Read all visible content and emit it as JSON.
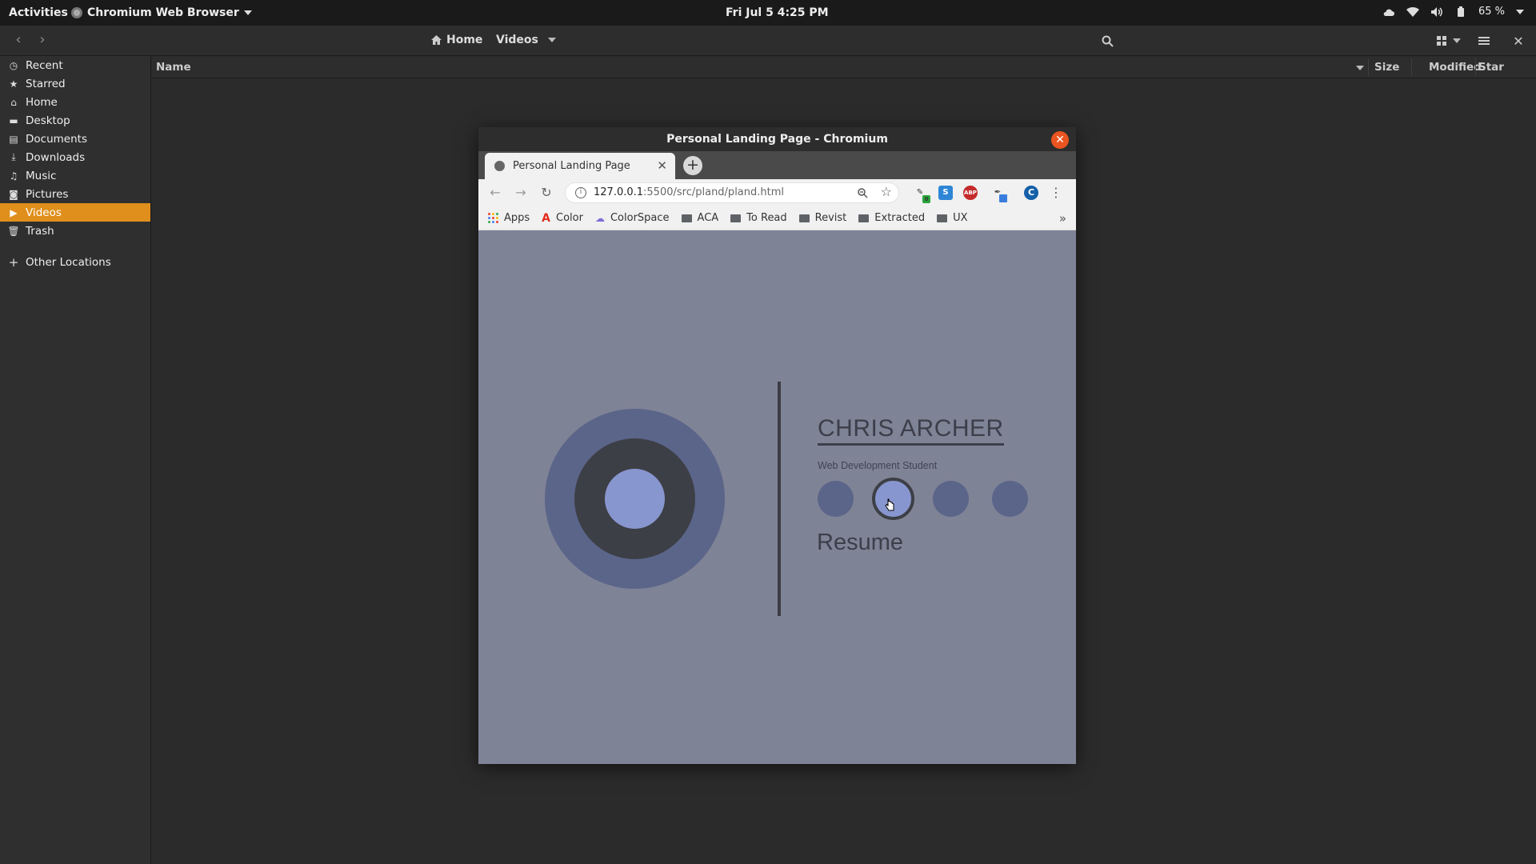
{
  "topbar": {
    "activities": "Activities",
    "app_name": "Chromium Web Browser",
    "clock": "Fri Jul 5   4:25 PM",
    "battery": "65 %"
  },
  "files": {
    "path_home": "Home",
    "path_current": "Videos",
    "columns": {
      "name": "Name",
      "size": "Size",
      "modified": "Modified",
      "star": "Star"
    },
    "sidebar": [
      {
        "label": "Recent",
        "icon": "clock-icon"
      },
      {
        "label": "Starred",
        "icon": "star-icon"
      },
      {
        "label": "Home",
        "icon": "home-icon"
      },
      {
        "label": "Desktop",
        "icon": "desktop-icon"
      },
      {
        "label": "Documents",
        "icon": "document-icon"
      },
      {
        "label": "Downloads",
        "icon": "download-icon"
      },
      {
        "label": "Music",
        "icon": "music-icon"
      },
      {
        "label": "Pictures",
        "icon": "camera-icon"
      },
      {
        "label": "Videos",
        "icon": "video-icon",
        "active": true
      },
      {
        "label": "Trash",
        "icon": "trash-icon"
      }
    ],
    "other_locations": "Other Locations"
  },
  "browser": {
    "window_title": "Personal Landing Page - Chromium",
    "tab_title": "Personal Landing Page",
    "url_host": "127.0.0.1",
    "url_path": ":5500/src/pland/pland.html",
    "profile_initial": "C",
    "bookmarks": [
      {
        "label": "Apps",
        "icon": "apps-grid-icon"
      },
      {
        "label": "Color",
        "icon": "adobe-icon"
      },
      {
        "label": "ColorSpace",
        "icon": "colorspace-icon"
      },
      {
        "label": "ACA",
        "icon": "folder-icon"
      },
      {
        "label": "To Read",
        "icon": "folder-icon"
      },
      {
        "label": "Revist",
        "icon": "folder-icon"
      },
      {
        "label": "Extracted",
        "icon": "folder-icon"
      },
      {
        "label": "UX",
        "icon": "folder-icon"
      }
    ]
  },
  "page": {
    "name": "CHRIS ARCHER",
    "subtitle": "Web Development Student",
    "resume": "Resume"
  },
  "colors": {
    "accent_orange": "#e08f1c",
    "close_orange": "#e95420",
    "page_bg": "#7f8396",
    "ring_blue": "#5b6589",
    "ring_dark": "#3d3f46",
    "ring_light": "#8896cf"
  }
}
